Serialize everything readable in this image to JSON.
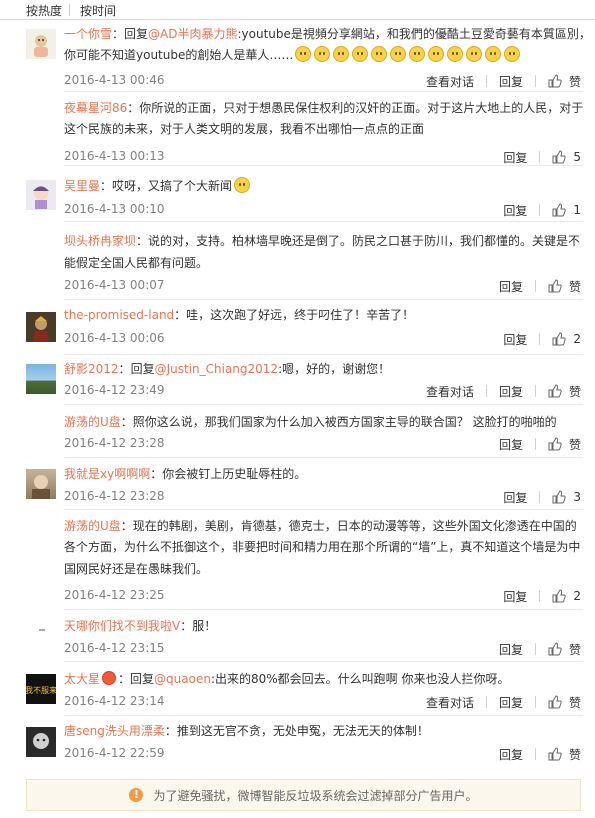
{
  "sort_tabs": {
    "hot": "按热度",
    "time": "按时间"
  },
  "actions": {
    "view_conversation": "查看对话",
    "reply": "回复",
    "like": "赞"
  },
  "comments": [
    {
      "user": "一个你雪",
      "lines": [
        [
          {
            "t": "："
          },
          {
            "t": "回复"
          },
          {
            "t": "@AD半肉暴力熊",
            "link": true
          },
          {
            "t": ":youtube是視頻分享網站，和我們的優酷土豆愛奇藝有本質區別，"
          }
        ],
        [
          {
            "t": "你可能不知道youtube的創始人是華人……"
          }
        ]
      ],
      "emoji_count": 12,
      "time": "2016-4-13 00:46",
      "view": true,
      "likes": ""
    },
    {
      "user": "夜幕星河86",
      "lines": [
        [
          {
            "t": "：你所说的正面，只对于想愚民保住权利的汉奸的正面。对于这片大地上的人民，对于"
          }
        ],
        [
          {
            "t": "这个民族的未来，对于人类文明的发展，我看不出哪怕一点点的正面"
          }
        ]
      ],
      "time": "2016-4-13 00:13",
      "view": false,
      "likes": "5"
    },
    {
      "user": "吴里曼",
      "lines": [
        [
          {
            "t": "：哎呀，又搞了个大新闻"
          }
        ]
      ],
      "emoji_count": 1,
      "time": "2016-4-13 00:10",
      "view": false,
      "likes": "1"
    },
    {
      "user": "坝头桥冉家坝",
      "lines": [
        [
          {
            "t": "：说的对，支持。柏林墙早晚还是倒了。防民之口甚于防川，我们都懂的。关键是不"
          }
        ],
        [
          {
            "t": "能假定全国人民都有问题。"
          }
        ]
      ],
      "time": "2016-4-13 00:07",
      "view": false,
      "likes": ""
    },
    {
      "user": "the-promised-land",
      "lines": [
        [
          {
            "t": "：哇，这次跑了好远，终于叼住了！辛苦了！"
          }
        ]
      ],
      "time": "2016-4-13 00:06",
      "view": false,
      "likes": "2"
    },
    {
      "user": "舒影2012",
      "lines": [
        [
          {
            "t": "："
          },
          {
            "t": "回复"
          },
          {
            "t": "@Justin_Chiang2012",
            "link": true
          },
          {
            "t": ":嗯，好的，谢谢您！"
          }
        ]
      ],
      "time": "2016-4-12 23:49",
      "view": true,
      "likes": ""
    },
    {
      "user": "游荡的U盘",
      "lines": [
        [
          {
            "t": "：照你这么说，那我们国家为什么加入被西方国家主导的联合国？ 这脸打的啪啪的"
          }
        ]
      ],
      "time": "2016-4-12 23:28",
      "view": false,
      "likes": ""
    },
    {
      "user": "我就是xy啊啊啊",
      "lines": [
        [
          {
            "t": "：你会被钉上历史耻辱柱的。"
          }
        ]
      ],
      "time": "2016-4-12 23:28",
      "view": false,
      "likes": "3"
    },
    {
      "user": "游荡的U盘",
      "lines": [
        [
          {
            "t": "：现在的韩剧，美剧，肯德基，德克士，日本的动漫等等，这些外国文化渗透在中国的"
          }
        ],
        [
          {
            "t": "各个方面，为什么不抵御这个，非要把时间和精力用在那个所谓的“墙”上，真不知道这个墙是为中"
          }
        ],
        [
          {
            "t": "国网民好还是在愚昧我们。"
          }
        ]
      ],
      "time": "2016-4-12 23:25",
      "view": false,
      "likes": "2"
    },
    {
      "user": "天哪你们找不到我啦V",
      "lines": [
        [
          {
            "t": "：服！"
          }
        ]
      ],
      "time": "2016-4-12 23:15",
      "view": false,
      "likes": ""
    },
    {
      "user": "太大星",
      "badge": true,
      "lines": [
        [
          {
            "t": "："
          },
          {
            "t": "回复"
          },
          {
            "t": "@quaoen",
            "link": true
          },
          {
            "t": ":出来的80%都会回去。什么叫跑啊 你来也没人拦你呀。"
          }
        ]
      ],
      "time": "2016-4-12 23:14",
      "view": true,
      "likes": ""
    },
    {
      "user": "唐seng洗头用漂柔",
      "lines": [
        [
          {
            "t": "：推到这无官不贪，无处申冤，无法无天的体制！"
          }
        ]
      ],
      "time": "2016-4-12 22:59",
      "view": false,
      "likes": ""
    }
  ],
  "avatar_texts": {
    "c11": "我不服来"
  },
  "notice": "为了避免骚扰，微博智能反垃圾系统会过滤掉部分广告用户。",
  "colors": {
    "username": "#eb7350",
    "time": "#808080",
    "notice_bg": "#fcf7ec"
  }
}
